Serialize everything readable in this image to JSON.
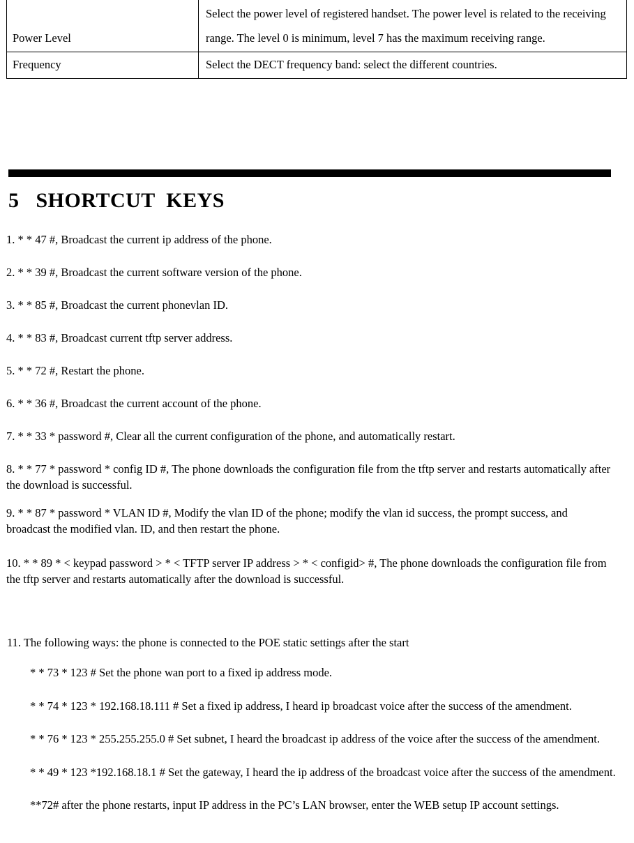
{
  "spec_table": {
    "rows": [
      {
        "label": "Power Level",
        "description": "Select the power level of registered handset. The power level is related to the receiving range. The level 0 is minimum, level 7 has the maximum receiving range."
      },
      {
        "label": "Frequency",
        "description": "Select the DECT frequency band: select the different countries."
      }
    ]
  },
  "section": {
    "number": "5",
    "title": "SHORTCUT  KEYS",
    "heading_full": "5   SHORTCUT  KEYS"
  },
  "shortcuts": [
    "1. * * 47 #, Broadcast the current ip address of the phone.",
    "2. * * 39 #, Broadcast the current software version of the phone.",
    "3. * * 85 #, Broadcast the current phonevlan ID.",
    "4. * * 83 #, Broadcast current tftp server address.",
    "5. * * 72 #, Restart the phone.",
    "6. * * 36 #, Broadcast the current account of the phone.",
    "7. * * 33 * password #, Clear all the current configuration of the phone, and automatically restart.",
    "8. * * 77 * password * config ID #, The phone downloads the configuration file from the tftp server and restarts automatically after the download is successful.",
    "9. * * 87 * password * VLAN ID #, Modify the vlan ID of the phone; modify the vlan id success, the prompt success, and broadcast the modified vlan. ID, and then restart the phone.",
    "10. * * 89 * < keypad password > * < TFTP server IP address > * < configid> #, The phone downloads the configuration file from the tftp server and restarts automatically after the download is successful."
  ],
  "step_block": {
    "lead": "11. The following ways: the phone is connected to the POE static settings after the start",
    "sub_steps": [
      "* * 73 * 123 #    Set the phone wan port to a fixed ip address mode.",
      "* * 74 * 123 * 192.168.18.111 #    Set a fixed ip address, I heard ip broadcast voice after the success of the amendment.",
      "* * 76 * 123 * 255.255.255.0 #    Set subnet, I heard the broadcast ip address of the voice after the success of the amendment.",
      "* * 49 * 123 *192.168.18.1 #    Set the gateway, I heard the ip address of the broadcast voice after the success of the amendment.",
      "**72# after the phone restarts, input IP address in the PC’s LAN browser, enter the WEB setup IP account settings."
    ]
  }
}
